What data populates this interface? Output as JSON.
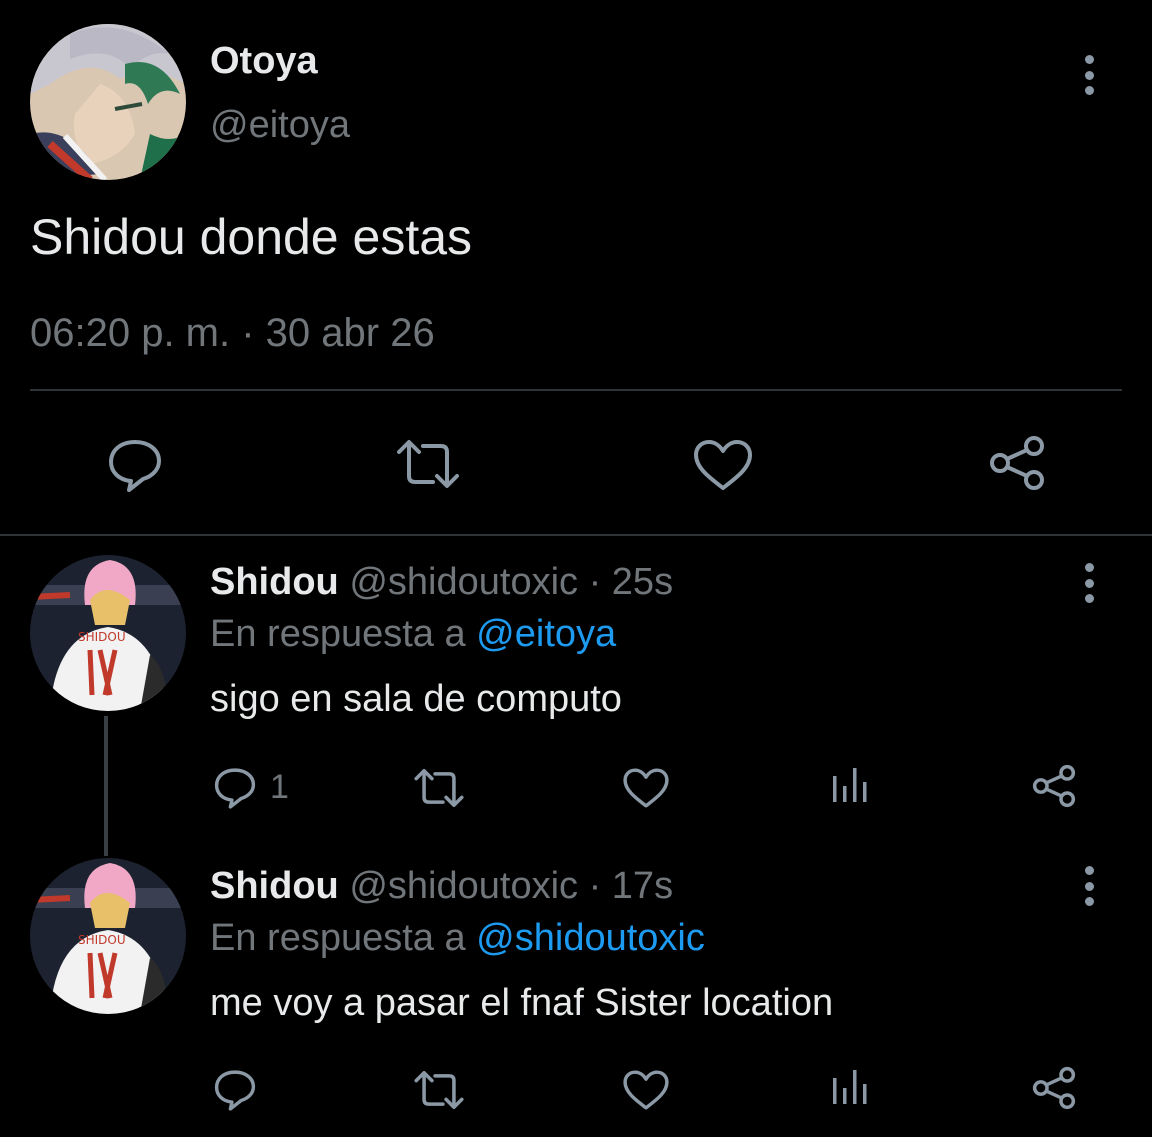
{
  "main_tweet": {
    "display_name": "Otoya",
    "handle": "@eitoya",
    "text": "Shidou donde estas",
    "timestamp": "06:20 p. m. · 30 abr 26",
    "actions": [
      "reply-icon",
      "retweet-icon",
      "like-icon",
      "share-icon"
    ]
  },
  "replies": [
    {
      "display_name": "Shidou",
      "handle": "@shidoutoxic",
      "separator": " · ",
      "time": "25s",
      "reply_prefix": "En respuesta a ",
      "reply_to": "@eitoya",
      "text": "sigo en sala de computo",
      "reply_count": "1",
      "avatar_lettering": "SHIDOU",
      "avatar_number": "13"
    },
    {
      "display_name": "Shidou",
      "handle": "@shidoutoxic",
      "separator": " · ",
      "time": "17s",
      "reply_prefix": "En respuesta a ",
      "reply_to": "@shidoutoxic",
      "text": "me voy a pasar el fnaf Sister location",
      "reply_count": "",
      "avatar_lettering": "SHIDOU",
      "avatar_number": "13"
    }
  ],
  "colors": {
    "background": "#000000",
    "text": "#e7e9ea",
    "secondary": "#71767b",
    "link": "#1d9bf0",
    "divider": "#2f3336"
  }
}
